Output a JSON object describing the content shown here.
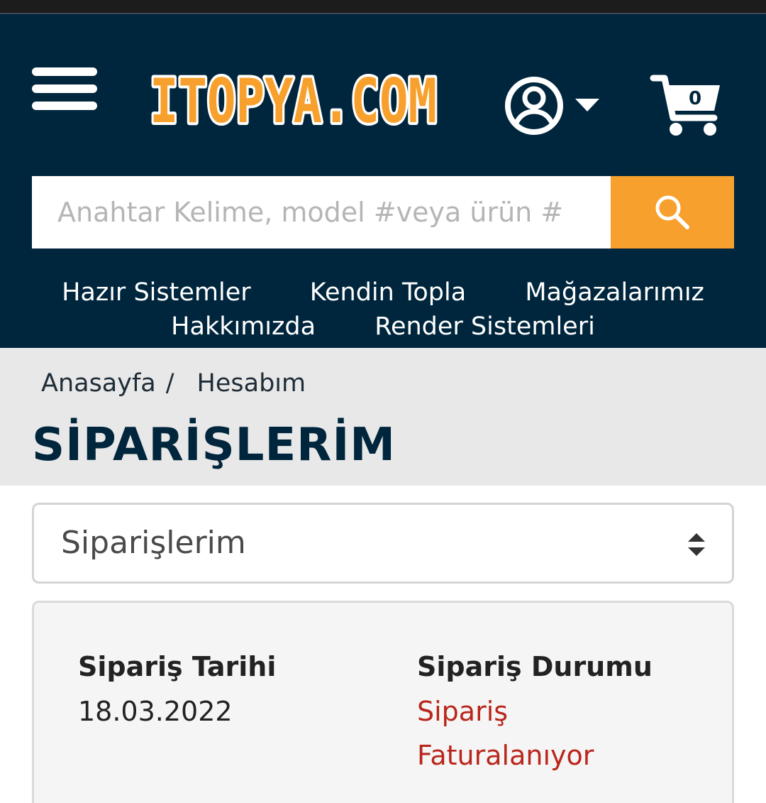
{
  "header": {
    "logo_text": "ITOPYA.COM",
    "cart_count": "0"
  },
  "search": {
    "placeholder": "Anahtar Kelime, model #veya ürün #"
  },
  "nav": {
    "row1": [
      "Hazır Sistemler",
      "Kendin Topla",
      "Mağazalarımız"
    ],
    "row2": [
      "Hakkımızda",
      "Render Sistemleri"
    ]
  },
  "breadcrumb": {
    "home": "Anasayfa",
    "separator": "/",
    "current": "Hesabım"
  },
  "page_title": "SİPARİŞLERİM",
  "account_menu": {
    "selected": "Siparişlerim"
  },
  "order": {
    "date_label": "Sipariş Tarihi",
    "date_value": "18.03.2022",
    "status_label": "Sipariş Durumu",
    "status_value": "Sipariş Faturalanıyor"
  },
  "colors": {
    "header_bg": "#00263d",
    "accent_orange": "#f7a02d",
    "status_red": "#b9261b",
    "crumb_bg": "#e8e8e8"
  },
  "icons": {
    "menu": "hamburger-icon",
    "account": "user-circle-icon",
    "account_dropdown": "caret-down-icon",
    "cart": "cart-icon",
    "search": "search-icon",
    "select": "sort-arrows-icon"
  }
}
